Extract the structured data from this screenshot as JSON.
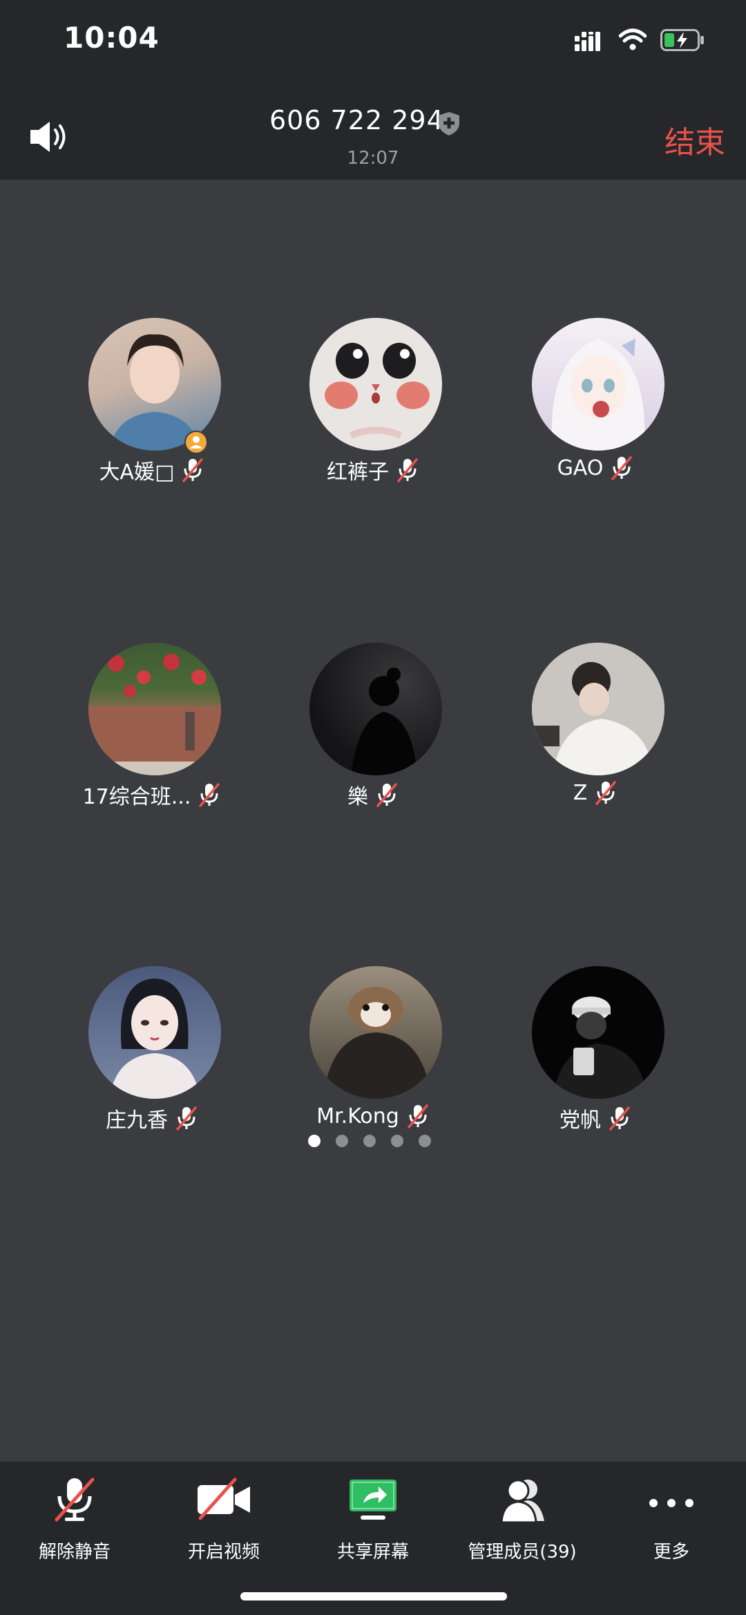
{
  "status_bar": {
    "time": "10:04"
  },
  "header": {
    "meeting_id": "606 722 294",
    "duration": "12:07",
    "end_label": "结束"
  },
  "members": [
    {
      "name": "大A媛□",
      "muted": true,
      "host": true,
      "avatar_colors": [
        "#c9b3a4",
        "#5b83a8"
      ]
    },
    {
      "name": "红裤子",
      "muted": true,
      "host": false,
      "avatar_colors": [
        "#eae6e3",
        "#d56a5a"
      ]
    },
    {
      "name": "GAO",
      "muted": true,
      "host": false,
      "avatar_colors": [
        "#f2eef3",
        "#c8b6d6"
      ]
    },
    {
      "name": "17综合班...",
      "muted": true,
      "host": false,
      "avatar_colors": [
        "#9a5044",
        "#4b6a38"
      ]
    },
    {
      "name": "樂",
      "muted": true,
      "host": false,
      "avatar_colors": [
        "#2a2a2c",
        "#0f0f10"
      ]
    },
    {
      "name": "Z",
      "muted": true,
      "host": false,
      "avatar_colors": [
        "#d9d6d2",
        "#6a6560"
      ]
    },
    {
      "name": "庄九香",
      "muted": true,
      "host": false,
      "avatar_colors": [
        "#5a6a8c",
        "#e8e4e6"
      ]
    },
    {
      "name": "Mr.Kong",
      "muted": true,
      "host": false,
      "avatar_colors": [
        "#7a6a58",
        "#2e2a26"
      ]
    },
    {
      "name": "党帆",
      "muted": true,
      "host": false,
      "avatar_colors": [
        "#4a4a4a",
        "#050505"
      ]
    }
  ],
  "pagination": {
    "total": 5,
    "current": 1
  },
  "toolbar": {
    "unmute_label": "解除静音",
    "video_label": "开启视频",
    "share_label": "共享屏幕",
    "members_label": "管理成员(39)",
    "more_label": "更多"
  },
  "colors": {
    "accent_red": "#e9524b",
    "share_green": "#2fbf63",
    "host_badge": "#f2a93b"
  }
}
